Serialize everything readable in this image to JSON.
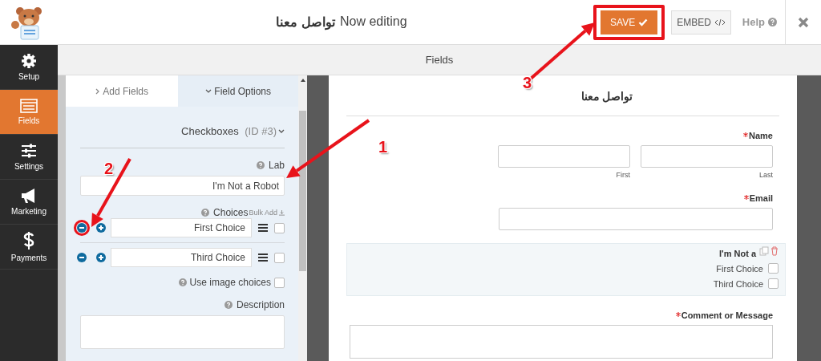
{
  "header": {
    "editing_label": "Now editing",
    "form_name": "تواصل معنا",
    "buttons": [
      {
        "kind": "save",
        "label": "SAVE",
        "annotated": true
      },
      {
        "kind": "embed",
        "label": "EMBED",
        "annotated": false
      }
    ],
    "help": "Help"
  },
  "nav": [
    {
      "kind": "gear",
      "label": "Setup",
      "selected": false
    },
    {
      "kind": "list",
      "label": "Fields",
      "selected": true
    },
    {
      "kind": "sliders",
      "label": "Settings",
      "selected": false
    },
    {
      "kind": "megaphone",
      "label": "Marketing",
      "selected": false
    },
    {
      "kind": "dollar",
      "label": "Payments",
      "selected": false
    }
  ],
  "toolbar_title": "Fields",
  "panel": {
    "tabs": [
      {
        "label": "Add Fields",
        "selected": false
      },
      {
        "label": "Field Options",
        "selected": true
      }
    ],
    "field_type": "Checkboxes",
    "field_id": "(ID #3)",
    "label_caption": "Lab",
    "label_value": "I'm Not a Robot",
    "choices_caption": "Choices",
    "bulk_add": "Bulk Add",
    "choices": [
      {
        "value": "First Choice",
        "checked": false,
        "annotated": true
      },
      {
        "value": "Third Choice",
        "checked": false,
        "annotated": false
      }
    ],
    "image_choices": {
      "label": "Use image choices",
      "checked": false
    },
    "description_caption": "Description"
  },
  "preview": {
    "title": "تواصل معنا",
    "fields": [
      {
        "kind": "name",
        "label": "Name",
        "required": true,
        "selected": false,
        "sublabels": [
          "First",
          "Last"
        ]
      },
      {
        "kind": "email",
        "label": "Email",
        "required": true,
        "selected": false
      },
      {
        "kind": "checkboxes",
        "label": "I'm Not a",
        "required": false,
        "selected": true,
        "choices": [
          {
            "label": "First Choice",
            "checked": false
          },
          {
            "label": "Third Choice",
            "checked": false
          }
        ]
      },
      {
        "kind": "textarea",
        "label": "Comment or Message",
        "required": true,
        "selected": false
      }
    ]
  },
  "annotations": [
    {
      "number": "1"
    },
    {
      "number": "2"
    },
    {
      "number": "3"
    }
  ]
}
